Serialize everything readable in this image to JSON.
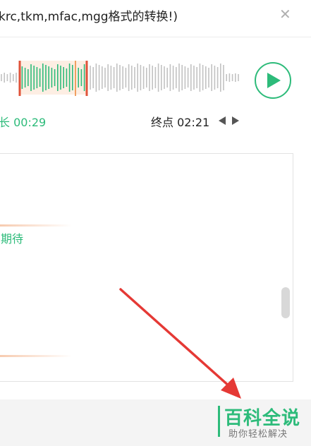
{
  "header": {
    "title": "krc,tkm,mfac,mgg格式的转换!)",
    "close_glyph": "✕"
  },
  "player": {
    "play_icon": "play-icon",
    "accent_color": "#2dbb7a",
    "marker_color": "#e0533a"
  },
  "timeline": {
    "duration_text": "长 00:29",
    "end_text": "终点 02:21",
    "prev_icon": "caret-left-icon",
    "next_icon": "caret-right-icon"
  },
  "panel": {
    "text": "期待"
  },
  "watermark": {
    "title": "百科全说",
    "subtitle": "助你轻松解决"
  }
}
